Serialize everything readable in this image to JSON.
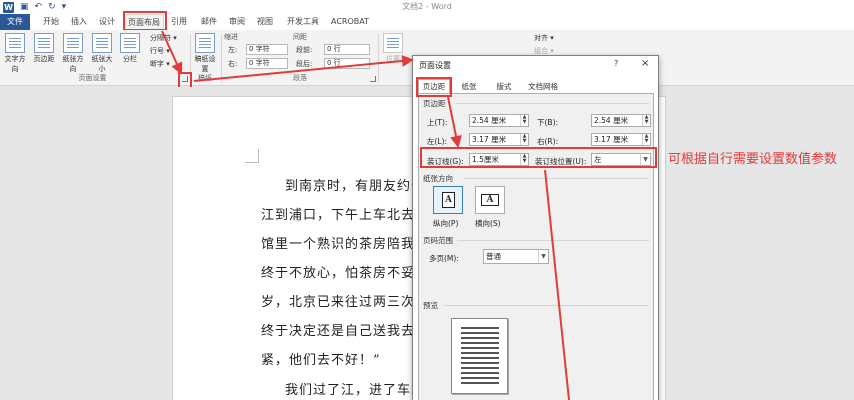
{
  "window": {
    "title": "文档2 - Word"
  },
  "tabs": [
    {
      "label": "文件"
    },
    {
      "label": "开始"
    },
    {
      "label": "插入"
    },
    {
      "label": "设计"
    },
    {
      "label": "页面布局"
    },
    {
      "label": "引用"
    },
    {
      "label": "邮件"
    },
    {
      "label": "审阅"
    },
    {
      "label": "视图"
    },
    {
      "label": "开发工具"
    },
    {
      "label": "ACROBAT"
    }
  ],
  "ribbon": {
    "page_setup": {
      "buttons": [
        {
          "label": "文字方向"
        },
        {
          "label": "页边距"
        },
        {
          "label": "纸张方向"
        },
        {
          "label": "纸张大小"
        },
        {
          "label": "分栏"
        }
      ],
      "small": [
        {
          "label": "分隔符 ▾"
        },
        {
          "label": "行号 ▾"
        },
        {
          "label": "断字 ▾"
        }
      ],
      "group_label": "页面设置"
    },
    "draft": {
      "button": "稿纸设置",
      "group_label": "稿纸"
    },
    "paragraph": {
      "indent_header": "缩进",
      "spacing_header": "间距",
      "left_label": "左:",
      "left_value": "0 字符",
      "right_label": "右:",
      "right_value": "0 字符",
      "before_label": "段前:",
      "before_value": "0 行",
      "after_label": "段后:",
      "after_value": "0 行",
      "group_label": "段落"
    },
    "arrange": {
      "buttons": [
        {
          "label": "位置"
        },
        {
          "label": "对齐 ▾"
        },
        {
          "label": "组合 ▾"
        }
      ]
    }
  },
  "document": {
    "lines": [
      "到南京时，有朋友约去",
      "江到浦口，下午上车北去",
      "馆里一个熟识的茶房陪我",
      "终于不放心，怕茶房不妥",
      "岁，北京已来往过两三次",
      "终于决定还是自己送我去",
      "紧，他们去不好！”",
      "我们过了江，进了车站"
    ]
  },
  "dialog": {
    "title": "页面设置",
    "help": "?",
    "close": "×",
    "tabs": [
      {
        "label": "页边距"
      },
      {
        "label": "纸张"
      },
      {
        "label": "版式"
      },
      {
        "label": "文档网格"
      }
    ],
    "margins_section": "页边距",
    "top_label": "上(T):",
    "top_value": "2.54 厘米",
    "bottom_label": "下(B):",
    "bottom_value": "2.54 厘米",
    "left_label": "左(L):",
    "left_value": "3.17 厘米",
    "right_label": "右(R):",
    "right_value": "3.17 厘米",
    "gutter_label": "装订线(G):",
    "gutter_value": "1.5厘米",
    "gutter_pos_label": "装订线位置(U):",
    "gutter_pos_value": "左",
    "orientation_section": "纸张方向",
    "portrait_label": "纵向(P)",
    "landscape_label": "横向(S)",
    "orient_glyph": "A",
    "pages_section": "页码范围",
    "multi_pages_label": "多页(M):",
    "multi_pages_value": "普通",
    "preview_section": "预览"
  },
  "annotation": {
    "text": "可根据自行需要设置数值参数",
    "color": "#e23b3b"
  },
  "colors": {
    "word_blue": "#2b579a",
    "highlight_red": "#e23b3b"
  }
}
